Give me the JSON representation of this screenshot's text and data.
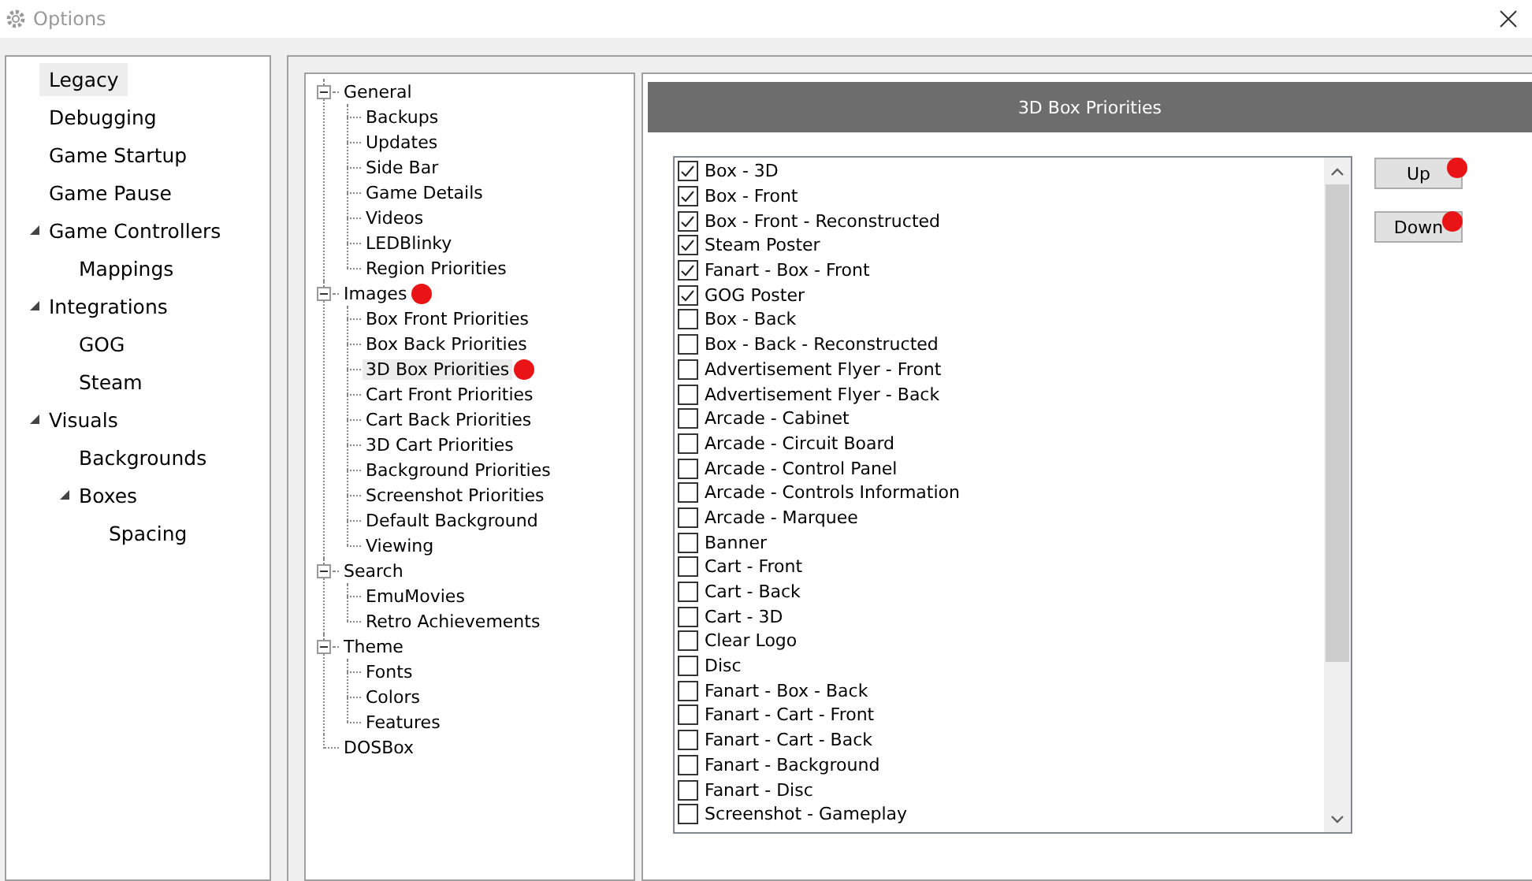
{
  "window": {
    "title": "Options"
  },
  "nav": [
    {
      "label": "Legacy",
      "selected": true,
      "expanded": false
    },
    {
      "label": "Debugging",
      "selected": false,
      "expanded": false
    },
    {
      "label": "Game Startup",
      "selected": false,
      "expanded": false
    },
    {
      "label": "Game Pause",
      "selected": false,
      "expanded": false
    },
    {
      "label": "Game Controllers",
      "selected": false,
      "expanded": true,
      "children": [
        {
          "label": "Mappings",
          "selected": false,
          "expanded": false
        }
      ]
    },
    {
      "label": "Integrations",
      "selected": false,
      "expanded": true,
      "children": [
        {
          "label": "GOG",
          "selected": false,
          "expanded": false
        },
        {
          "label": "Steam",
          "selected": false,
          "expanded": false
        }
      ]
    },
    {
      "label": "Visuals",
      "selected": false,
      "expanded": true,
      "children": [
        {
          "label": "Backgrounds",
          "selected": false,
          "expanded": false
        },
        {
          "label": "Boxes",
          "selected": false,
          "expanded": true,
          "children": [
            {
              "label": "Spacing",
              "selected": false,
              "expanded": false
            }
          ]
        }
      ]
    }
  ],
  "tree": [
    {
      "label": "General",
      "selected": false,
      "marked": false,
      "children": [
        {
          "label": "Backups",
          "selected": false,
          "marked": false
        },
        {
          "label": "Updates",
          "selected": false,
          "marked": false
        },
        {
          "label": "Side Bar",
          "selected": false,
          "marked": false
        },
        {
          "label": "Game Details",
          "selected": false,
          "marked": false
        },
        {
          "label": "Videos",
          "selected": false,
          "marked": false
        },
        {
          "label": "LEDBlinky",
          "selected": false,
          "marked": false
        },
        {
          "label": "Region Priorities",
          "selected": false,
          "marked": false
        }
      ]
    },
    {
      "label": "Images",
      "selected": false,
      "marked": true,
      "children": [
        {
          "label": "Box Front Priorities",
          "selected": false,
          "marked": false
        },
        {
          "label": "Box Back Priorities",
          "selected": false,
          "marked": false
        },
        {
          "label": "3D Box Priorities",
          "selected": true,
          "marked": true
        },
        {
          "label": "Cart Front Priorities",
          "selected": false,
          "marked": false
        },
        {
          "label": "Cart Back Priorities",
          "selected": false,
          "marked": false
        },
        {
          "label": "3D Cart Priorities",
          "selected": false,
          "marked": false
        },
        {
          "label": "Background Priorities",
          "selected": false,
          "marked": false
        },
        {
          "label": "Screenshot Priorities",
          "selected": false,
          "marked": false
        },
        {
          "label": "Default Background",
          "selected": false,
          "marked": false
        },
        {
          "label": "Viewing",
          "selected": false,
          "marked": false
        }
      ]
    },
    {
      "label": "Search",
      "selected": false,
      "marked": false,
      "children": [
        {
          "label": "EmuMovies",
          "selected": false,
          "marked": false
        },
        {
          "label": "Retro Achievements",
          "selected": false,
          "marked": false
        }
      ]
    },
    {
      "label": "Theme",
      "selected": false,
      "marked": false,
      "children": [
        {
          "label": "Fonts",
          "selected": false,
          "marked": false
        },
        {
          "label": "Colors",
          "selected": false,
          "marked": false
        },
        {
          "label": "Features",
          "selected": false,
          "marked": false
        }
      ]
    },
    {
      "label": "DOSBox",
      "selected": false,
      "marked": false
    }
  ],
  "panel": {
    "title": "3D Box Priorities",
    "items": [
      {
        "label": "Box - 3D",
        "checked": true
      },
      {
        "label": "Box - Front",
        "checked": true
      },
      {
        "label": "Box - Front - Reconstructed",
        "checked": true
      },
      {
        "label": "Steam Poster",
        "checked": true
      },
      {
        "label": "Fanart - Box - Front",
        "checked": true
      },
      {
        "label": "GOG Poster",
        "checked": true
      },
      {
        "label": "Box - Back",
        "checked": false
      },
      {
        "label": "Box - Back - Reconstructed",
        "checked": false
      },
      {
        "label": "Advertisement Flyer - Front",
        "checked": false
      },
      {
        "label": "Advertisement Flyer - Back",
        "checked": false
      },
      {
        "label": "Arcade - Cabinet",
        "checked": false
      },
      {
        "label": "Arcade - Circuit Board",
        "checked": false
      },
      {
        "label": "Arcade - Control Panel",
        "checked": false
      },
      {
        "label": "Arcade - Controls Information",
        "checked": false
      },
      {
        "label": "Arcade - Marquee",
        "checked": false
      },
      {
        "label": "Banner",
        "checked": false
      },
      {
        "label": "Cart - Front",
        "checked": false
      },
      {
        "label": "Cart - Back",
        "checked": false
      },
      {
        "label": "Cart - 3D",
        "checked": false
      },
      {
        "label": "Clear Logo",
        "checked": false
      },
      {
        "label": "Disc",
        "checked": false
      },
      {
        "label": "Fanart - Box - Back",
        "checked": false
      },
      {
        "label": "Fanart - Cart - Front",
        "checked": false
      },
      {
        "label": "Fanart - Cart - Back",
        "checked": false
      },
      {
        "label": "Fanart - Background",
        "checked": false
      },
      {
        "label": "Fanart - Disc",
        "checked": false
      },
      {
        "label": "Screenshot - Gameplay",
        "checked": false
      }
    ],
    "buttons": [
      {
        "label": "Up",
        "marked": true
      },
      {
        "label": "Down",
        "marked": true
      }
    ]
  }
}
